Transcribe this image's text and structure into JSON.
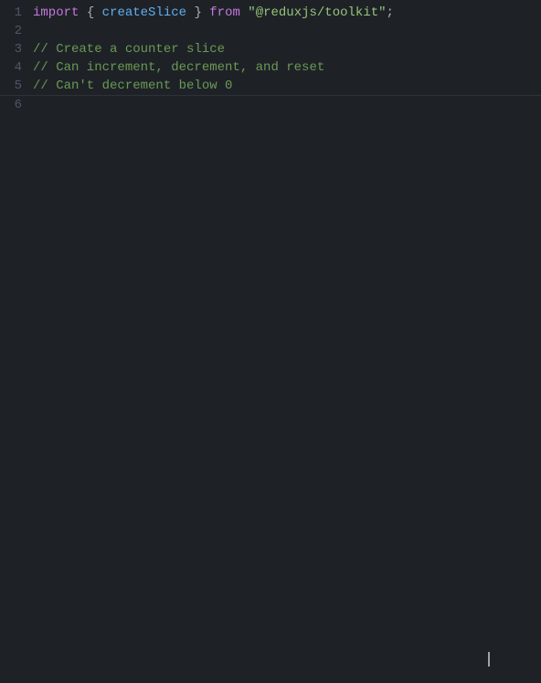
{
  "editor": {
    "background": "#1e2227",
    "lines": [
      {
        "number": "1",
        "tokens": [
          {
            "type": "keyword",
            "text": "import"
          },
          {
            "type": "plain",
            "text": " "
          },
          {
            "type": "punctuation",
            "text": "{"
          },
          {
            "type": "plain",
            "text": " "
          },
          {
            "type": "function-name",
            "text": "createSlice"
          },
          {
            "type": "plain",
            "text": " "
          },
          {
            "type": "punctuation",
            "text": "}"
          },
          {
            "type": "plain",
            "text": " "
          },
          {
            "type": "keyword",
            "text": "from"
          },
          {
            "type": "plain",
            "text": " "
          },
          {
            "type": "string",
            "text": "\"@reduxjs/toolkit\""
          },
          {
            "type": "punctuation",
            "text": ";"
          }
        ]
      },
      {
        "number": "2",
        "tokens": []
      },
      {
        "number": "3",
        "tokens": [
          {
            "type": "comment",
            "text": "// Create a counter slice"
          }
        ]
      },
      {
        "number": "4",
        "tokens": [
          {
            "type": "comment",
            "text": "// Can increment, decrement, and reset"
          }
        ]
      },
      {
        "number": "5",
        "tokens": [
          {
            "type": "comment",
            "text": "// Can't decrement below 0"
          }
        ]
      },
      {
        "number": "6",
        "tokens": []
      }
    ]
  },
  "cursor": {
    "visible": true
  }
}
